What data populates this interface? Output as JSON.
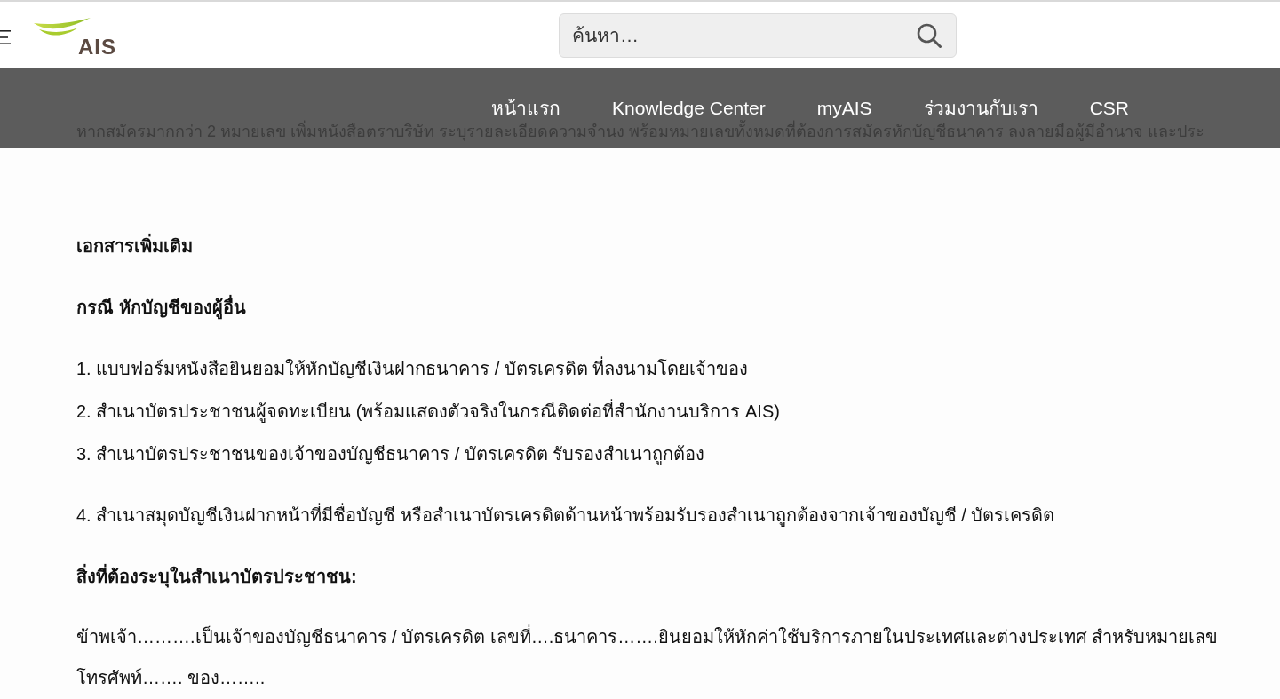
{
  "header": {
    "logo": {
      "text": "AIS"
    },
    "search": {
      "placeholder": "ค้นหา…"
    }
  },
  "nav": {
    "items": [
      "หน้าแรก",
      "Knowledge Center",
      "myAIS",
      "ร่วมงานกับเรา",
      "CSR"
    ]
  },
  "content": {
    "partial_line": "หากสมัครมากกว่า 2 หมายเลข เพิ่มหนังสือตราบริษัท ระบุรายละเอียดความจำนง พร้อมหมายเลขทั้งหมดที่ต้องการสมัครหักบัญชีธนาคาร ลงลายมือผู้มีอำนาจ และประ",
    "blocks": [
      {
        "kind": "heading",
        "lines": [
          "เอกสารเพิ่มเติม"
        ]
      },
      {
        "kind": "heading",
        "lines": [
          "กรณี หักบัญชีของผู้อื่น"
        ]
      },
      {
        "kind": "list",
        "lines": [
          "1. แบบฟอร์มหนังสือยินยอมให้หักบัญชีเงินฝากธนาคาร / บัตรเครดิต ที่ลงนามโดยเจ้าของ",
          "2. สำเนาบัตรประชาชนผู้จดทะเบียน (พร้อมแสดงตัวจริงในกรณีติดต่อที่สำนักงานบริการ AIS)",
          "3. สำเนาบัตรประชาชนของเจ้าของบัญชีธนาคาร / บัตรเครดิต รับรองสำเนาถูกต้อง"
        ]
      },
      {
        "kind": "list",
        "lines": [
          "4. สำเนาสมุดบัญชีเงินฝากหน้าที่มีชื่อบัญชี หรือสำเนาบัตรเครดิตด้านหน้าพร้อมรับรองสำเนาถูกต้องจากเจ้าของบัญชี / บัตรเครดิต"
        ]
      },
      {
        "kind": "heading",
        "lines": [
          "สิ่งที่ต้องระบุในสำเนาบัตรประชาชน:"
        ]
      },
      {
        "kind": "paragraph",
        "lines": [
          "ข้าพเจ้า……….เป็นเจ้าของบัญชีธนาคาร / บัตรเครดิต เลขที่….ธนาคาร…….ยินยอมให้หักค่าใช้บริการภายในประเทศและต่างประเทศ สำหรับหมายเลขโทรศัพท์……. ของ…….."
        ]
      }
    ]
  }
}
